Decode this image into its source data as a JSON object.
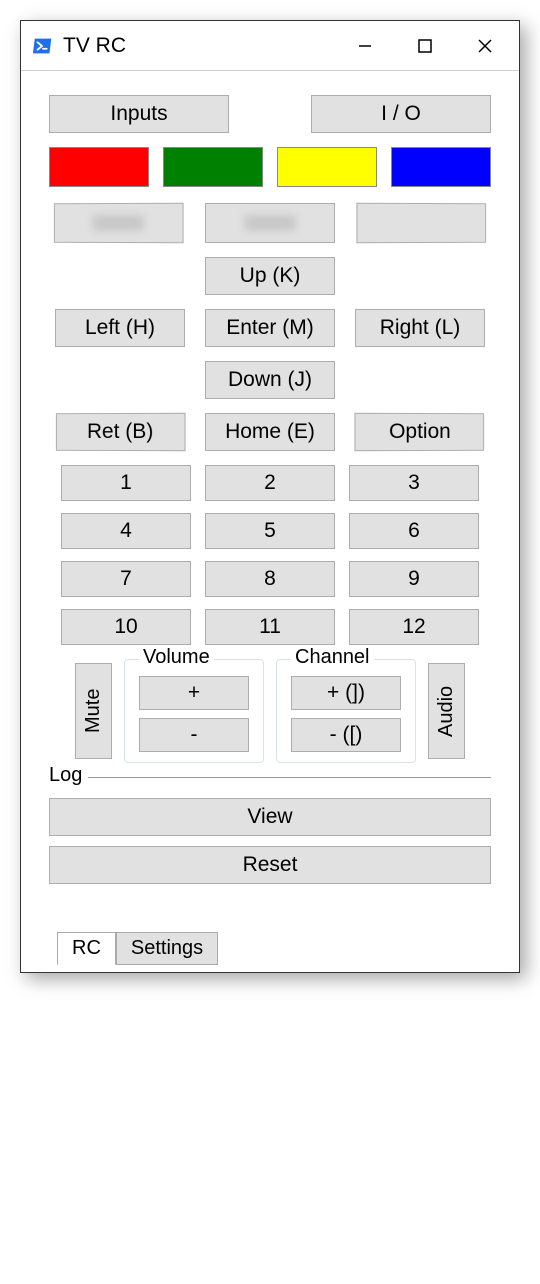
{
  "window": {
    "title": "TV RC"
  },
  "top": {
    "inputs": "Inputs",
    "io": "I / O"
  },
  "color_buttons": [
    "red",
    "green",
    "yellow",
    "blue"
  ],
  "nav": {
    "up": "Up (K)",
    "left": "Left (H)",
    "enter": "Enter (M)",
    "right": "Right (L)",
    "down": "Down (J)"
  },
  "mid": {
    "ret": "Ret (B)",
    "home": "Home (E)",
    "option": "Option"
  },
  "numbers": [
    "1",
    "2",
    "3",
    "4",
    "5",
    "6",
    "7",
    "8",
    "9",
    "10",
    "11",
    "12"
  ],
  "mute": "Mute",
  "audio": "Audio",
  "volume": {
    "label": "Volume",
    "plus": "+",
    "minus": "-"
  },
  "channel": {
    "label": "Channel",
    "plus": "+ (])",
    "minus": "- ([)"
  },
  "log": {
    "label": "Log",
    "view": "View",
    "reset": "Reset"
  },
  "tabs": {
    "rc": "RC",
    "settings": "Settings"
  }
}
